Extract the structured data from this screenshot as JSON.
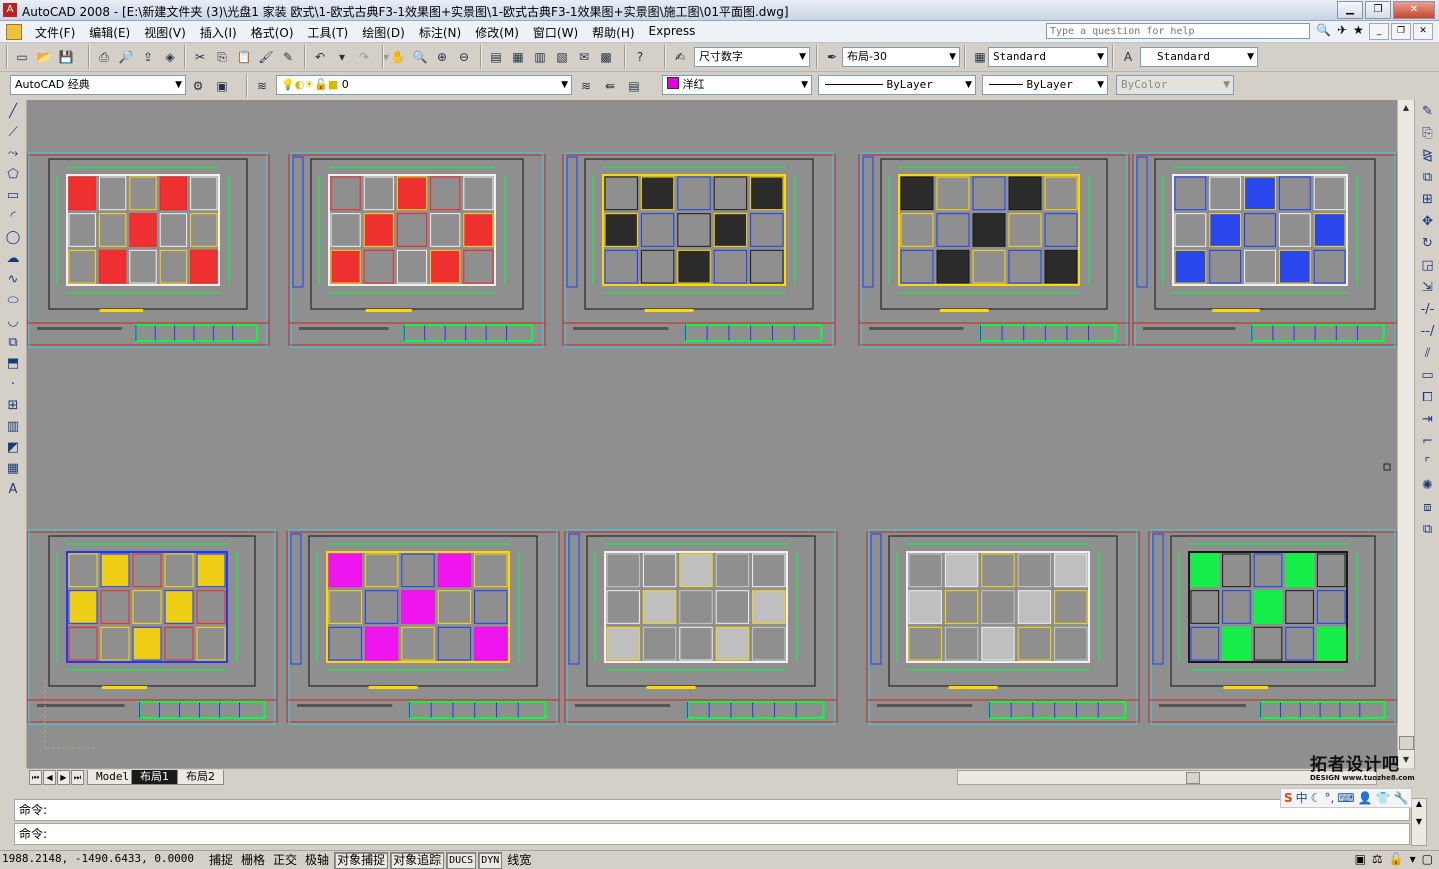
{
  "window": {
    "title": "AutoCAD 2008 - [E:\\新建文件夹 (3)\\光盘1 家装 欧式\\1-欧式古典F3-1效果图+实景图\\1-欧式古典F3-1效果图+实景图\\施工图\\01平面图.dwg]",
    "app_icon": "A"
  },
  "menu": {
    "items": [
      "文件(F)",
      "编辑(E)",
      "视图(V)",
      "插入(I)",
      "格式(O)",
      "工具(T)",
      "绘图(D)",
      "标注(N)",
      "修改(M)",
      "窗口(W)",
      "帮助(H)",
      "Express"
    ],
    "help_placeholder": "Type a question for help"
  },
  "toolbar": {
    "dimstyle_label": "尺寸数字",
    "mleader_label": "布局-30",
    "tablestyle_label": "Standard",
    "textstyle_label": "Standard",
    "workspace_label": "AutoCAD 经典",
    "layer_label": "0",
    "color_label": "洋红",
    "linetype_label": "ByLayer",
    "lineweight_label": "ByLayer",
    "plotstyle_label": "ByColor"
  },
  "tabs": {
    "model": "Model",
    "layout1": "布局1",
    "layout2": "布局2",
    "active": "layout1"
  },
  "command": {
    "line1": "命令:",
    "line2": "命令:"
  },
  "status": {
    "coords": "1988.2148, -1490.6433, 0.0000",
    "buttons": [
      {
        "label": "捕捉",
        "on": false
      },
      {
        "label": "栅格",
        "on": false
      },
      {
        "label": "正交",
        "on": false
      },
      {
        "label": "极轴",
        "on": false
      },
      {
        "label": "对象捕捉",
        "on": true
      },
      {
        "label": "对象追踪",
        "on": true
      },
      {
        "label": "DUCS",
        "on": true
      },
      {
        "label": "DYN",
        "on": true
      },
      {
        "label": "线宽",
        "on": false
      }
    ]
  },
  "watermark": {
    "brand": "拓者设计吧",
    "sub": "DESIGN www.tuozhe8.com"
  },
  "ime": {
    "mode": "中"
  },
  "icons": {
    "left_tools": [
      "line-icon",
      "construction-line-icon",
      "polyline-icon",
      "polygon-icon",
      "rectangle-icon",
      "arc-icon",
      "circle-icon",
      "revision-cloud-icon",
      "spline-icon",
      "ellipse-icon",
      "ellipse-arc-icon",
      "insert-block-icon",
      "make-block-icon",
      "point-icon",
      "hatch-icon",
      "gradient-icon",
      "region-icon",
      "table-icon",
      "mtext-icon"
    ],
    "right_tools": [
      "erase-icon",
      "copy-icon",
      "mirror-icon",
      "offset-icon",
      "array-icon",
      "move-icon",
      "rotate-icon",
      "scale-icon",
      "stretch-icon",
      "trim-icon",
      "extend-icon",
      "break-at-point-icon",
      "break-icon",
      "join-icon",
      "chamfer-icon",
      "fillet-icon",
      "explode-icon",
      "draworder-icon",
      "bring-front-icon",
      "send-back-icon"
    ]
  },
  "colors": {
    "canvas": "#8f8f8f",
    "sheet_border_red": "#d81e1e",
    "viewport_cyan": "#2fd6e0",
    "accent_green": "#00ff3c"
  }
}
